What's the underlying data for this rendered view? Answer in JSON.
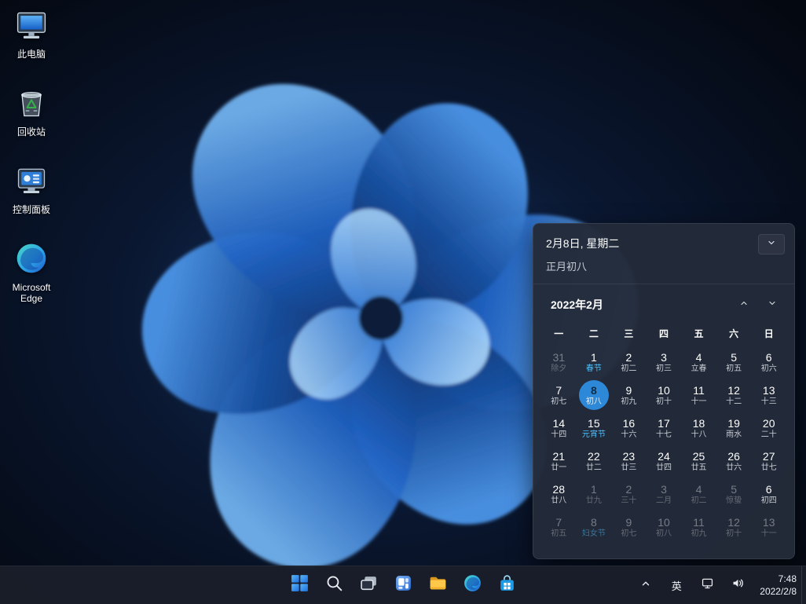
{
  "colors": {
    "accent": "#4cc2ff",
    "today_circle": "#2d88d8",
    "taskbar_bg": "#191e2a",
    "calendar_bg": "#232a39"
  },
  "desktop_icons": [
    {
      "name": "this-pc",
      "label": "此电脑"
    },
    {
      "name": "recycle-bin",
      "label": "回收站"
    },
    {
      "name": "control-panel",
      "label": "控制面板"
    },
    {
      "name": "microsoft-edge",
      "label": "Microsoft Edge"
    }
  ],
  "calendar": {
    "header_date": "2月8日, 星期二",
    "header_lunar": "正月初八",
    "month_label": "2022年2月",
    "weekdays": [
      "一",
      "二",
      "三",
      "四",
      "五",
      "六",
      "日"
    ],
    "days": [
      {
        "num": "31",
        "lunar": "除夕",
        "dim": true
      },
      {
        "num": "1",
        "lunar": "春节",
        "festival": true
      },
      {
        "num": "2",
        "lunar": "初二"
      },
      {
        "num": "3",
        "lunar": "初三"
      },
      {
        "num": "4",
        "lunar": "立春"
      },
      {
        "num": "5",
        "lunar": "初五"
      },
      {
        "num": "6",
        "lunar": "初六"
      },
      {
        "num": "7",
        "lunar": "初七"
      },
      {
        "num": "8",
        "lunar": "初八",
        "today": true
      },
      {
        "num": "9",
        "lunar": "初九"
      },
      {
        "num": "10",
        "lunar": "初十"
      },
      {
        "num": "11",
        "lunar": "十一"
      },
      {
        "num": "12",
        "lunar": "十二"
      },
      {
        "num": "13",
        "lunar": "十三"
      },
      {
        "num": "14",
        "lunar": "十四"
      },
      {
        "num": "15",
        "lunar": "元宵节",
        "festival": true
      },
      {
        "num": "16",
        "lunar": "十六"
      },
      {
        "num": "17",
        "lunar": "十七"
      },
      {
        "num": "18",
        "lunar": "十八"
      },
      {
        "num": "19",
        "lunar": "雨水"
      },
      {
        "num": "20",
        "lunar": "二十"
      },
      {
        "num": "21",
        "lunar": "廿一"
      },
      {
        "num": "22",
        "lunar": "廿二"
      },
      {
        "num": "23",
        "lunar": "廿三"
      },
      {
        "num": "24",
        "lunar": "廿四"
      },
      {
        "num": "25",
        "lunar": "廿五"
      },
      {
        "num": "26",
        "lunar": "廿六"
      },
      {
        "num": "27",
        "lunar": "廿七"
      },
      {
        "num": "28",
        "lunar": "廿八"
      },
      {
        "num": "1",
        "lunar": "廿九",
        "dim": true
      },
      {
        "num": "2",
        "lunar": "三十",
        "dim": true
      },
      {
        "num": "3",
        "lunar": "二月",
        "dim": true
      },
      {
        "num": "4",
        "lunar": "初二",
        "dim": true
      },
      {
        "num": "5",
        "lunar": "惊蛰",
        "dim": true
      },
      {
        "num": "6",
        "lunar": "初四"
      },
      {
        "num": "7",
        "lunar": "初五",
        "dim": true
      },
      {
        "num": "8",
        "lunar": "妇女节",
        "dim": true,
        "festival": true
      },
      {
        "num": "9",
        "lunar": "初七",
        "dim": true
      },
      {
        "num": "10",
        "lunar": "初八",
        "dim": true
      },
      {
        "num": "11",
        "lunar": "初九",
        "dim": true
      },
      {
        "num": "12",
        "lunar": "初十",
        "dim": true
      },
      {
        "num": "13",
        "lunar": "十一",
        "dim": true
      }
    ]
  },
  "taskbar": {
    "buttons": [
      {
        "icon": "start-icon"
      },
      {
        "icon": "search-icon"
      },
      {
        "icon": "task-view-icon"
      },
      {
        "icon": "widgets-icon"
      },
      {
        "icon": "file-explorer-icon"
      },
      {
        "icon": "edge-icon"
      },
      {
        "icon": "store-icon"
      }
    ]
  },
  "tray": {
    "ime_label": "英",
    "time": "7:48",
    "date": "2022/2/8"
  }
}
